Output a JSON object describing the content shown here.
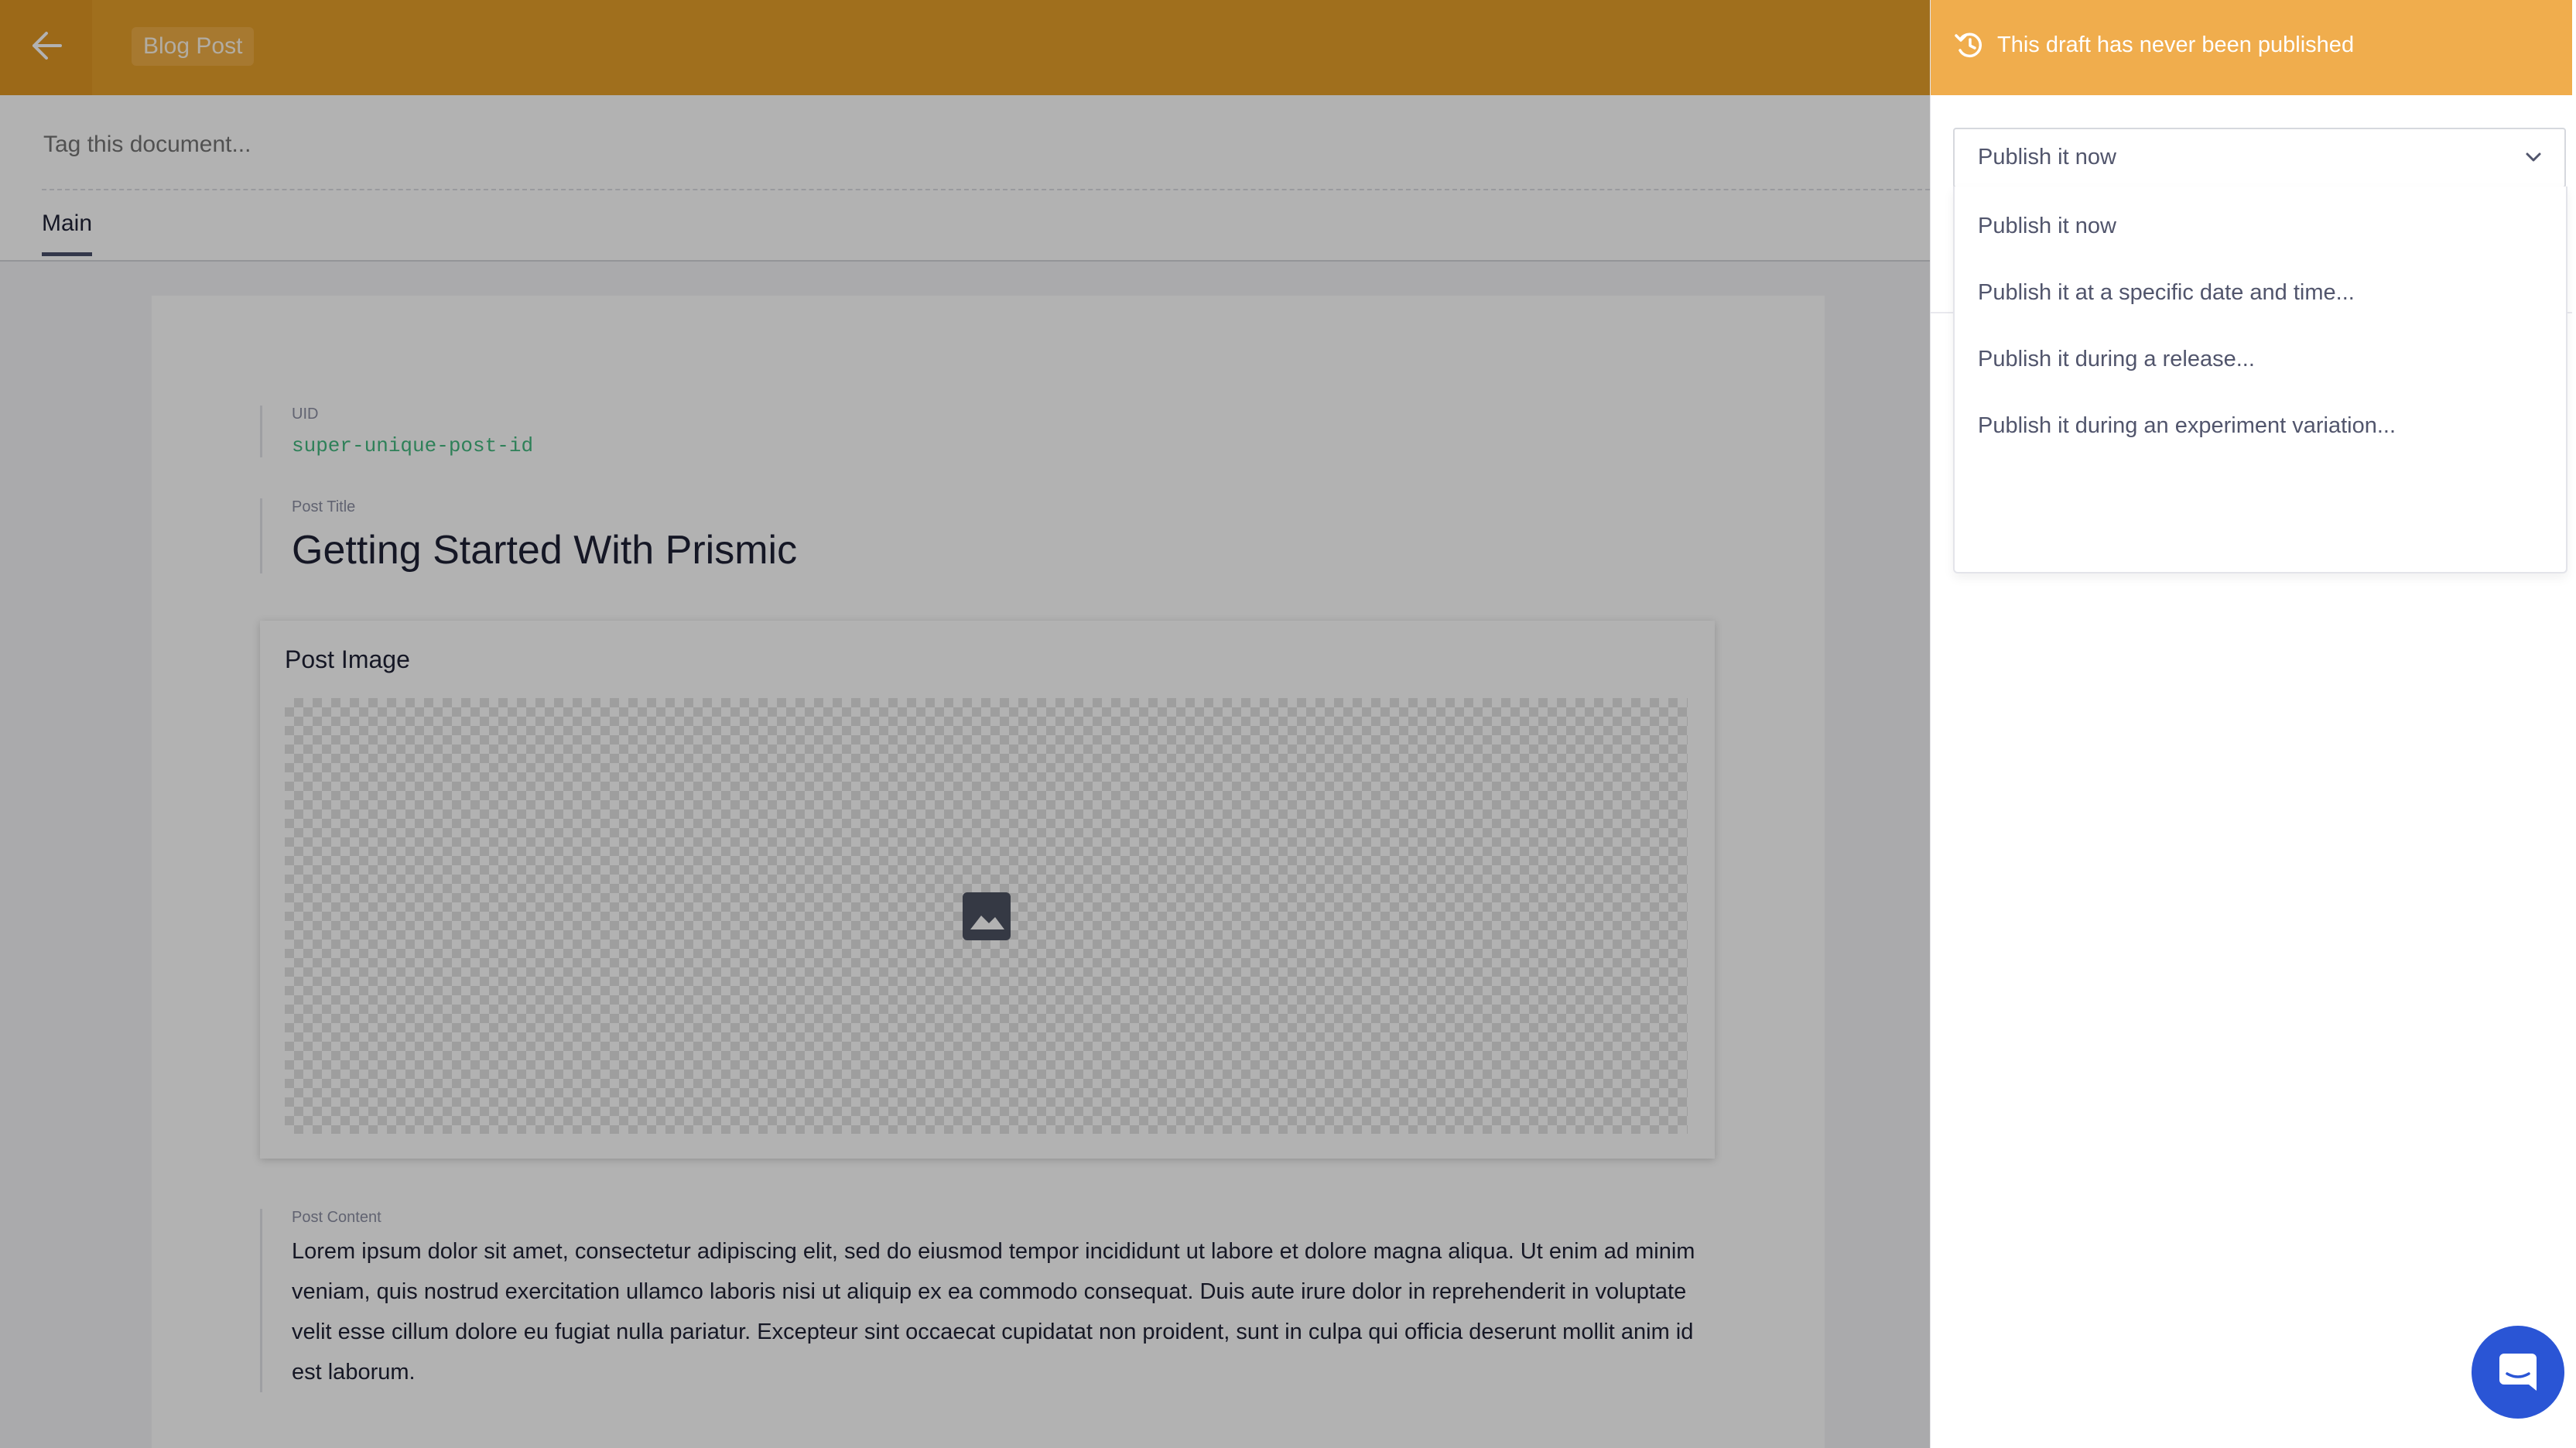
{
  "app": {
    "document_type": "Blog Post",
    "tag_placeholder": "Tag this document...",
    "tabs": [
      {
        "label": "Main"
      }
    ]
  },
  "document": {
    "uid": {
      "label": "UID",
      "value": "super-unique-post-id"
    },
    "title": {
      "label": "Post Title",
      "value": "Getting Started With Prismic"
    },
    "image": {
      "label": "Post Image"
    },
    "content": {
      "label": "Post Content",
      "value": "Lorem ipsum dolor sit amet, consectetur adipiscing elit, sed do eiusmod tempor incididunt ut labore et dolore magna aliqua. Ut enim ad minim veniam, quis nostrud exercitation ullamco laboris nisi ut aliquip ex ea commodo consequat. Duis aute irure dolor in reprehenderit in voluptate velit esse cillum dolore eu fugiat nulla pariatur. Excepteur sint occaecat cupidatat non proident, sunt in culpa qui officia deserunt mollit anim id est laborum."
    }
  },
  "publish_panel": {
    "status_text": "This draft has never been published",
    "selected": "Publish it now",
    "options": [
      "Publish it now",
      "Publish it at a specific date and time...",
      "Publish it during a release...",
      "Publish it during an experiment variation..."
    ]
  },
  "icons": {
    "back": "arrow-left-icon",
    "history": "history-icon",
    "chevron": "chevron-down-icon",
    "image_placeholder": "image-icon",
    "chat": "chat-icon"
  },
  "colors": {
    "topbar": "#e59f2a",
    "panel_header": "#f0ad4d",
    "uid_text": "#42b87f",
    "chat_button": "#2a55d5"
  }
}
